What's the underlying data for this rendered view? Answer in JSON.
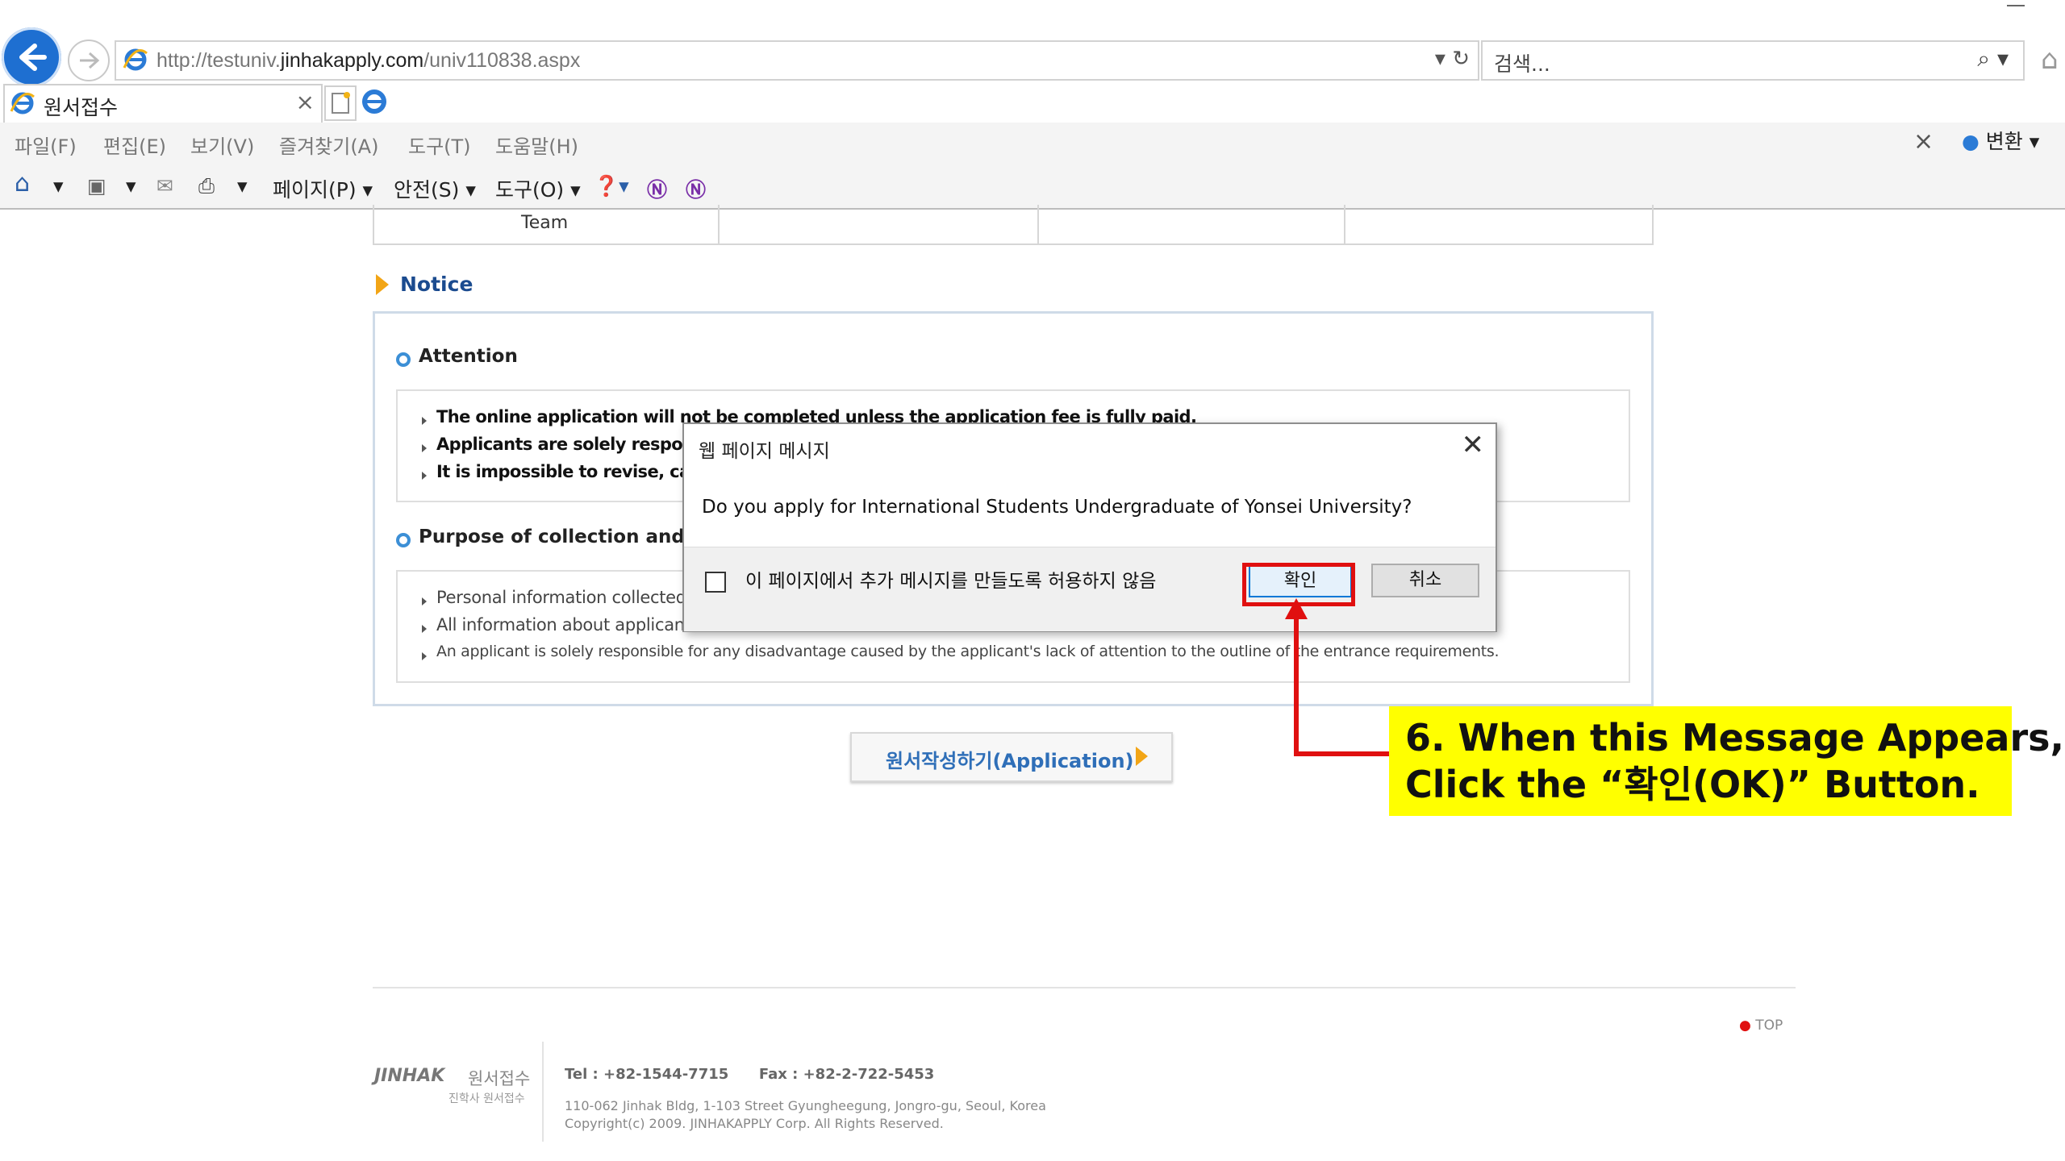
{
  "browser": {
    "url_prefix": "http://testuniv.",
    "url_domain": "jinhakapply.com",
    "url_path": "/univ110838.aspx",
    "address_controls": "▾ ↻",
    "search_placeholder": "검색...",
    "search_controls": "⌕ ▾",
    "tab_title": "원서접수",
    "tab_close": "×",
    "menu": [
      "파일(F)",
      "편집(E)",
      "보기(V)",
      "즐겨찾기(A)",
      "도구(T)",
      "도움말(H)"
    ],
    "menubar_close": "×",
    "translate_label": "변환",
    "toolbar": {
      "page": "페이지(P) ▾",
      "safety": "안전(S) ▾",
      "tools": "도구(O) ▾"
    }
  },
  "page": {
    "table_team": "Team",
    "notice_title": "Notice",
    "attention_title": "Attention",
    "attention_items": [
      "The online application will not be completed unless the application fee is fully paid.",
      "Applicants are solely respons",
      "It is impossible to revise, canc"
    ],
    "purpose_title": "Purpose of collection and u",
    "purpose_items": [
      "Personal information collected",
      "All information about applicant",
      "An applicant is solely responsible for any disadvantage caused by the applicant's lack of attention to the outline of the entrance requirements."
    ],
    "application_button": "원서작성하기(Application)"
  },
  "dialog": {
    "title": "웹 페이지 메시지",
    "close": "✕",
    "message": "Do you apply for International Students Undergraduate of Yonsei University?",
    "checkbox_label": "이 페이지에서 추가 메시지를 만들도록 허용하지 않음",
    "ok": "확인",
    "cancel": "취소"
  },
  "annotation": {
    "line1": "6. When this Message Appears,",
    "line2": "Click the “확인(OK)” Button."
  },
  "footer": {
    "top_link": "TOP",
    "logo_text": "JINHAK",
    "logo_kr": "원서접수",
    "logo_sub": "진학사 원서접수",
    "tel": "Tel : +82-1544-7715      Fax : +82-2-722-5453",
    "address": "110-062 Jinhak Bldg, 1-103 Street Gyungheegung, Jongro-gu, Seoul, Korea",
    "copyright": "Copyright(c) 2009. JINHAKAPPLY Corp. All Rights Reserved."
  },
  "colors": {
    "accent_blue": "#1e6fd1",
    "annotation_red": "#e01010",
    "callout_yellow": "#ffff00",
    "notice_blue": "#1b4b8f"
  }
}
